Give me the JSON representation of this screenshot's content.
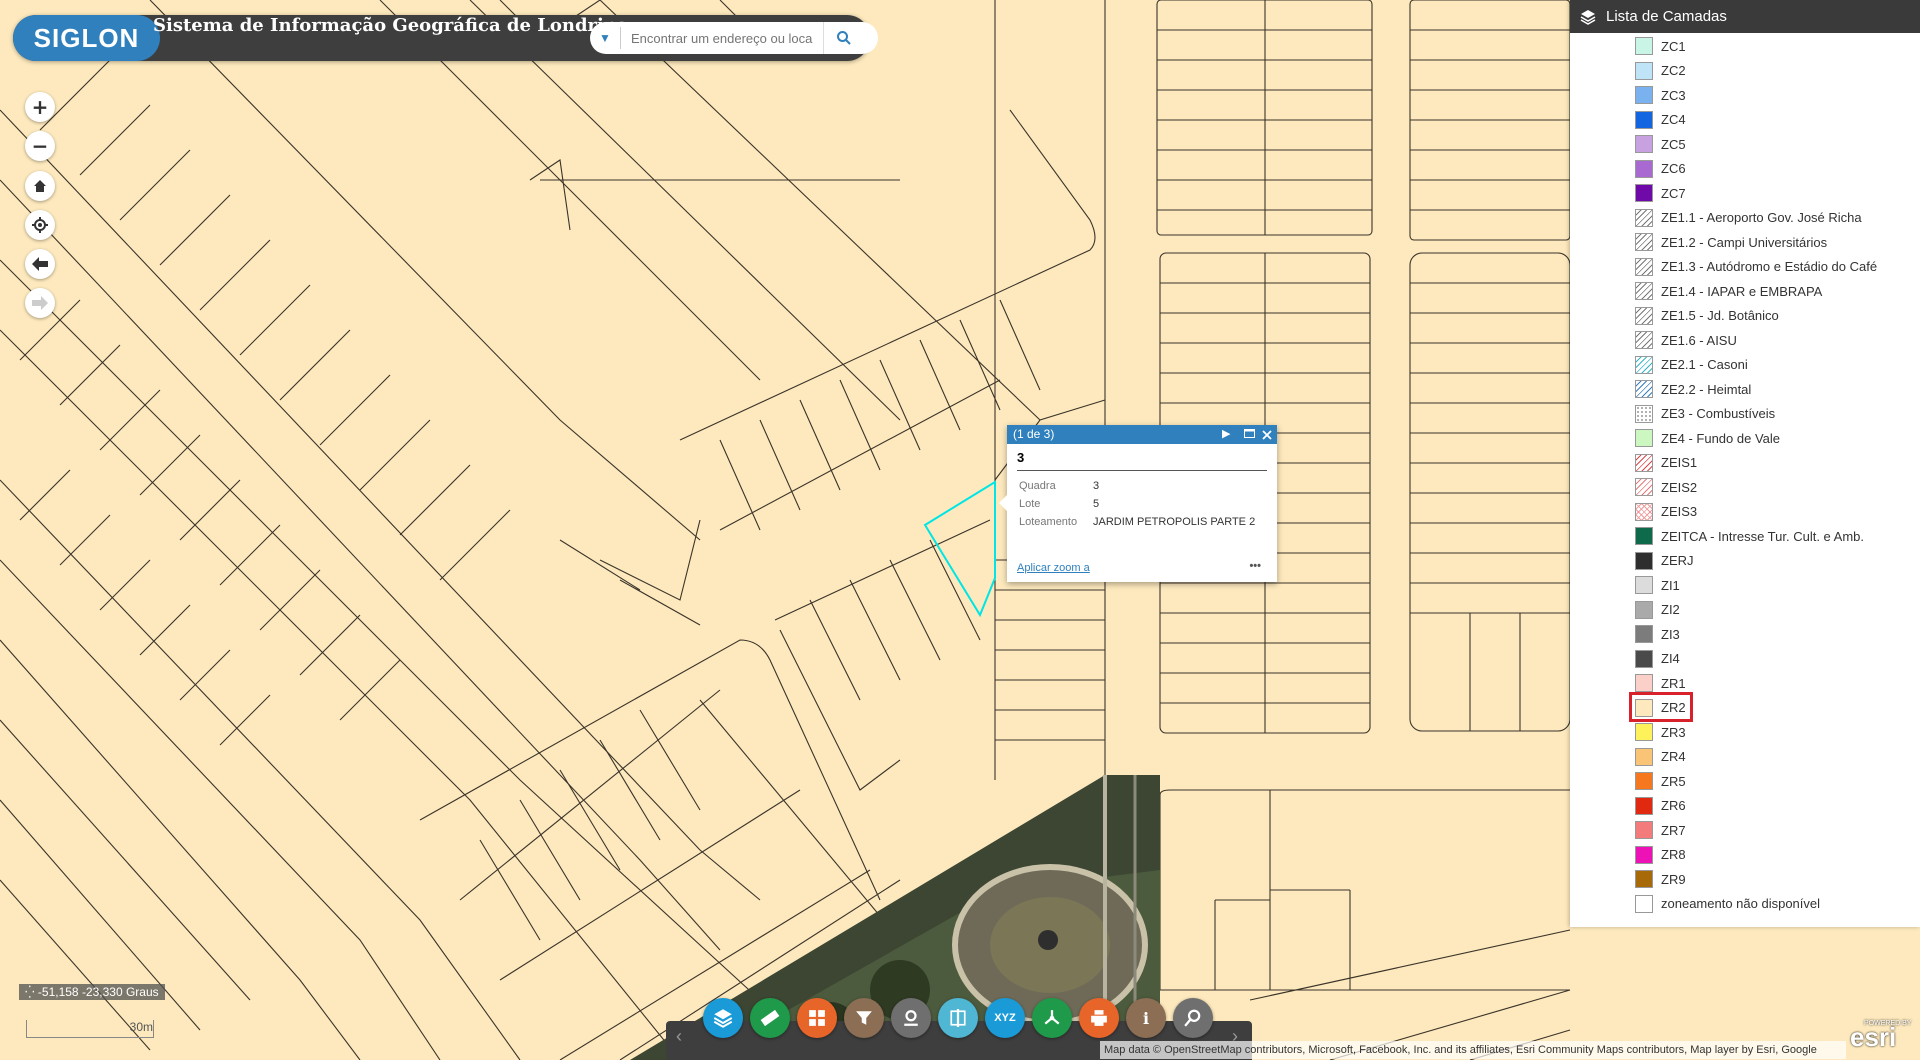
{
  "header": {
    "logo_text": "SIGLON",
    "title": "Sistema de Informação Geográfica de Londrina",
    "search_placeholder": "Encontrar um endereço ou loca"
  },
  "nav": {
    "zoom_in": "+",
    "zoom_out": "−",
    "home": "home-icon",
    "locate": "locate-icon",
    "back": "back-icon",
    "forward": "forward-icon"
  },
  "popup": {
    "counter": "(1 de 3)",
    "title": "3",
    "fields": [
      {
        "key": "Quadra",
        "value": "3"
      },
      {
        "key": "Lote",
        "value": "5"
      },
      {
        "key": "Loteamento",
        "value": "JARDIM PETROPOLIS PARTE 2"
      }
    ],
    "zoom_link": "Aplicar zoom a",
    "more": "•••"
  },
  "layers_panel": {
    "title": "Lista de Camadas",
    "items": [
      {
        "label": "ZC1",
        "color": "#c9f5e6",
        "pattern": "solid"
      },
      {
        "label": "ZC2",
        "color": "#bfe3f7",
        "pattern": "solid"
      },
      {
        "label": "ZC3",
        "color": "#79b2ef",
        "pattern": "solid"
      },
      {
        "label": "ZC4",
        "color": "#1366e0",
        "pattern": "solid"
      },
      {
        "label": "ZC5",
        "color": "#c8a2e0",
        "pattern": "solid"
      },
      {
        "label": "ZC6",
        "color": "#a869d0",
        "pattern": "solid"
      },
      {
        "label": "ZC7",
        "color": "#6f0aa8",
        "pattern": "solid"
      },
      {
        "label": "ZE1.1 - Aeroporto Gov. José Richa",
        "color": "#777777",
        "pattern": "hatch"
      },
      {
        "label": "ZE1.2 - Campi Universitários",
        "color": "#777777",
        "pattern": "hatch"
      },
      {
        "label": "ZE1.3 - Autódromo e Estádio do Café",
        "color": "#777777",
        "pattern": "hatch"
      },
      {
        "label": "ZE1.4 - IAPAR e EMBRAPA",
        "color": "#777777",
        "pattern": "hatch"
      },
      {
        "label": "ZE1.5 - Jd. Botânico",
        "color": "#777777",
        "pattern": "hatch"
      },
      {
        "label": "ZE1.6 - AISU",
        "color": "#777777",
        "pattern": "hatch"
      },
      {
        "label": "ZE2.1 - Casoni",
        "color": "#35b6c4",
        "pattern": "hatch"
      },
      {
        "label": "ZE2.2 - Heimtal",
        "color": "#3a7fbd",
        "pattern": "hatch"
      },
      {
        "label": "ZE3 - Combustíveis",
        "color": "#999999",
        "pattern": "dots"
      },
      {
        "label": "ZE4 - Fundo de Vale",
        "color": "#cdf7c0",
        "pattern": "solid"
      },
      {
        "label": "ZEIS1",
        "color": "#d9484b",
        "pattern": "hatch"
      },
      {
        "label": "ZEIS2",
        "color": "#e57a7a",
        "pattern": "hatch"
      },
      {
        "label": "ZEIS3",
        "color": "#ee9a9a",
        "pattern": "cross"
      },
      {
        "label": "ZEITCA - Intresse Tur. Cult. e Amb.",
        "color": "#0d6b4c",
        "pattern": "solid"
      },
      {
        "label": "ZERJ",
        "color": "#2e2e2e",
        "pattern": "solid"
      },
      {
        "label": "ZI1",
        "color": "#dcdcdc",
        "pattern": "solid"
      },
      {
        "label": "ZI2",
        "color": "#aaaaaa",
        "pattern": "solid"
      },
      {
        "label": "ZI3",
        "color": "#7c7c7c",
        "pattern": "solid"
      },
      {
        "label": "ZI4",
        "color": "#4a4a4a",
        "pattern": "solid"
      },
      {
        "label": "ZR1",
        "color": "#fbd0c8",
        "pattern": "solid"
      },
      {
        "label": "ZR2",
        "color": "#fde9bd",
        "pattern": "solid"
      },
      {
        "label": "ZR3",
        "color": "#fdf25a",
        "pattern": "solid"
      },
      {
        "label": "ZR4",
        "color": "#f9c476",
        "pattern": "solid"
      },
      {
        "label": "ZR5",
        "color": "#f5781e",
        "pattern": "solid"
      },
      {
        "label": "ZR6",
        "color": "#e1290f",
        "pattern": "solid"
      },
      {
        "label": "ZR7",
        "color": "#f47b7b",
        "pattern": "solid"
      },
      {
        "label": "ZR8",
        "color": "#ec12b5",
        "pattern": "solid"
      },
      {
        "label": "ZR9",
        "color": "#a86a08",
        "pattern": "solid"
      },
      {
        "label": "zoneamento não disponível",
        "color": "#ffffff",
        "pattern": "solid"
      }
    ],
    "highlighted": "ZR2"
  },
  "status": {
    "coordinates": "-51,158 -23,330 Graus",
    "scale": "30m"
  },
  "toolbar": {
    "tools": [
      {
        "icon": "layers-icon",
        "color": "#1a9ad6"
      },
      {
        "icon": "measure-icon",
        "color": "#1e9a4a"
      },
      {
        "icon": "grid-icon",
        "color": "#e8652a"
      },
      {
        "icon": "filter-icon",
        "color": "#8c6e55"
      },
      {
        "icon": "location-icon",
        "color": "#6f6f6f"
      },
      {
        "icon": "swipe-icon",
        "color": "#4fb6d3"
      },
      {
        "icon": "xyz-icon",
        "color": "#1a9ad6"
      },
      {
        "icon": "share-icon",
        "color": "#1e9a4a"
      },
      {
        "icon": "print-icon",
        "color": "#e8652a"
      },
      {
        "icon": "info-icon",
        "color": "#8c6e55"
      },
      {
        "icon": "query-icon",
        "color": "#6f6f6f"
      }
    ],
    "xyz_label": "XYZ"
  },
  "attribution": "Map data © OpenStreetMap contributors, Microsoft, Facebook, Inc. and its affiliates, Esri Community Maps contributors, Map layer by Esri, Google",
  "esri": {
    "powered_by": "POWERED BY",
    "brand": "esri"
  },
  "colors": {
    "map_fill": "#fde9bd",
    "parcel_line": "#4a4030",
    "selection": "#00e5e5",
    "accent": "#2f80bd"
  }
}
